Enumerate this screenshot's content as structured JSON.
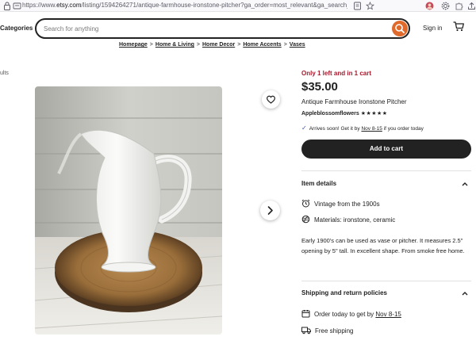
{
  "browser": {
    "url_prefix": "https://www.",
    "url_host": "etsy.com",
    "url_rest": "/listing/1594264271/antique-farmhouse-ironstone-pitcher?ga_order=most_relevant&ga_search_type=all&ga_v"
  },
  "header": {
    "categories_label": "Categories",
    "search_placeholder": "Search for anything",
    "signin_label": "Sign in"
  },
  "breadcrumb": [
    "Homepage",
    "Home & Living",
    "Home Decor",
    "Home Accents",
    "Vases"
  ],
  "left_fragment": "ults",
  "listing": {
    "stock_note": "Only 1 left and in 1 cart",
    "price": "$35.00",
    "title": "Antique Farmhouse Ironstone Pitcher",
    "shop_name": "Appleblossomflowers",
    "stars": "★★★★★",
    "arrive_prefix": "Arrives soon! Get it by ",
    "arrive_date": "Nov 8-15",
    "arrive_suffix": " if you order today",
    "add_to_cart": "Add to cart"
  },
  "item_details": {
    "heading": "Item details",
    "features": [
      "Vintage from the 1900s",
      "Materials: ironstone, ceramic"
    ],
    "description": "Early 1900's can be used as vase or pitcher. It measures 2.5\" opening by 5\" tall. In excellent shape. From smoke free home."
  },
  "shipping": {
    "heading": "Shipping and return policies",
    "order_prefix": "Order today to get by ",
    "order_date": "Nov 8-15",
    "free_shipping": "Free shipping"
  },
  "colors": {
    "accent": "#e06a2b",
    "stock_red": "#a61a2e",
    "button_dark": "#222222"
  }
}
